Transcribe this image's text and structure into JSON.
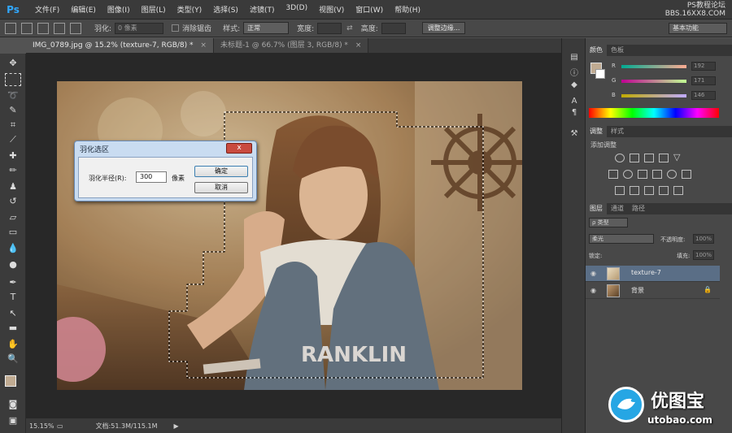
{
  "app": {
    "logo": "Ps"
  },
  "menu": [
    "文件(F)",
    "编辑(E)",
    "图像(I)",
    "图层(L)",
    "类型(Y)",
    "选择(S)",
    "滤镜(T)",
    "3D(D)",
    "视图(V)",
    "窗口(W)",
    "帮助(H)"
  ],
  "watermark_top": {
    "line1": "PS教程论坛",
    "line2": "BBS.16XX8.COM"
  },
  "options": {
    "feather_label": "羽化:",
    "feather_value": "0 像素",
    "antialias_label": "消除锯齿",
    "style_label": "样式:",
    "style_value": "正常",
    "width_label": "宽度:",
    "height_label": "高度:",
    "refine_edge": "调整边缘...",
    "workspace": "基本功能"
  },
  "tabs": [
    {
      "label": "IMG_0789.jpg @ 15.2% (texture-7, RGB/8) *",
      "close": "×"
    },
    {
      "label": "未标题-1 @ 66.7% (图层 3, RGB/8) *",
      "close": "×"
    }
  ],
  "status": {
    "zoom": "15.15%",
    "doc": "文档:51.3M/115.1M"
  },
  "panels": {
    "color_tabs": [
      "颜色",
      "色板"
    ],
    "sliders": [
      {
        "letter": "R",
        "value": "192"
      },
      {
        "letter": "G",
        "value": "171"
      },
      {
        "letter": "B",
        "value": "146"
      }
    ],
    "adjust_tabs": [
      "调整",
      "样式"
    ],
    "adjust_title": "添加调整",
    "layer_tabs": [
      "图层",
      "通道",
      "路径"
    ],
    "layer_filter": "ρ 类型",
    "blend_mode": "柔光",
    "opacity_label": "不透明度:",
    "opacity_value": "100%",
    "lock_label": "锁定:",
    "fill_label": "填充:",
    "fill_value": "100%",
    "layers": [
      {
        "name": "texture-7"
      },
      {
        "name": "背景"
      }
    ]
  },
  "dialog": {
    "title": "羽化选区",
    "close": "x",
    "radius_label": "羽化半径(R):",
    "radius_value": "300",
    "unit": "像素",
    "ok": "确定",
    "cancel": "取消"
  },
  "watermark_bottom": {
    "name": "优图宝",
    "url": "utobao.com"
  }
}
